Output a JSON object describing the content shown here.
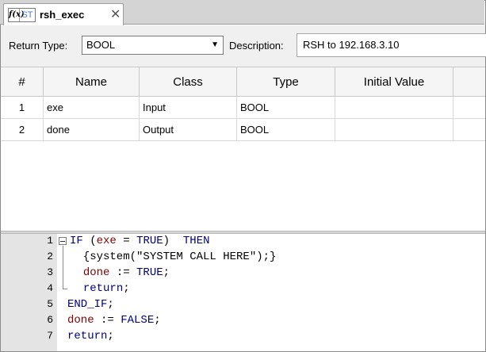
{
  "tab": {
    "icon_fx": "f(x)",
    "icon_st": "ST",
    "title": "rsh_exec",
    "close_glyph": "✕"
  },
  "props": {
    "return_type_label": "Return Type:",
    "return_type_value": "BOOL",
    "description_label": "Description:",
    "description_value": "RSH to 192.168.3.10"
  },
  "grid": {
    "columns": [
      "#",
      "Name",
      "Class",
      "Type",
      "Initial Value"
    ],
    "rows": [
      {
        "num": "1",
        "name": "exe",
        "class": "Input",
        "type": "BOOL",
        "initial": ""
      },
      {
        "num": "2",
        "name": "done",
        "class": "Output",
        "type": "BOOL",
        "initial": ""
      }
    ]
  },
  "editor": {
    "line_numbers": [
      "1",
      "2",
      "3",
      "4",
      "5",
      "6",
      "7"
    ],
    "lines": [
      [
        {
          "t": "IF",
          "c": "kw"
        },
        {
          "t": " (",
          "c": "tx"
        },
        {
          "t": "exe",
          "c": "id"
        },
        {
          "t": " = ",
          "c": "tx"
        },
        {
          "t": "TRUE",
          "c": "kw"
        },
        {
          "t": ")  ",
          "c": "tx"
        },
        {
          "t": "THEN",
          "c": "kw"
        }
      ],
      [
        {
          "t": "  {system(\"SYSTEM CALL HERE\");}",
          "c": "tx"
        }
      ],
      [
        {
          "t": "  ",
          "c": "tx"
        },
        {
          "t": "done",
          "c": "id"
        },
        {
          "t": " := ",
          "c": "tx"
        },
        {
          "t": "TRUE",
          "c": "kw"
        },
        {
          "t": ";",
          "c": "tx"
        }
      ],
      [
        {
          "t": "  ",
          "c": "tx"
        },
        {
          "t": "return",
          "c": "kw"
        },
        {
          "t": ";",
          "c": "tx"
        }
      ],
      [
        {
          "t": "END_IF",
          "c": "kw"
        },
        {
          "t": ";",
          "c": "tx"
        }
      ],
      [
        {
          "t": "done",
          "c": "id"
        },
        {
          "t": " := ",
          "c": "tx"
        },
        {
          "t": "FALSE",
          "c": "kw"
        },
        {
          "t": ";",
          "c": "tx"
        }
      ],
      [
        {
          "t": "return",
          "c": "kw"
        },
        {
          "t": ";",
          "c": "tx"
        }
      ]
    ]
  },
  "colors": {
    "keyword": "#00007f",
    "identifier": "#7f0000",
    "icon_st": "#4a7bd0"
  }
}
